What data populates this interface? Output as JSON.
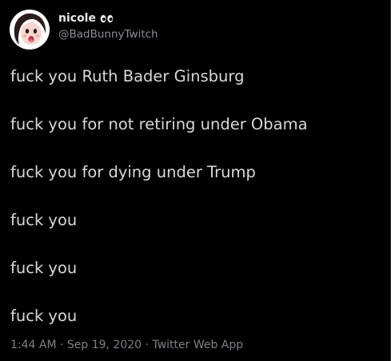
{
  "author": {
    "display_name": "nicole",
    "name_emoji_icon": "eyes-icon",
    "handle": "@BadBunnyTwitch",
    "avatar_icon": "cartoon-face-avatar"
  },
  "tweet": {
    "lines": [
      "fuck you Ruth Bader Ginsburg",
      "fuck you for not retiring under Obama",
      "fuck you for dying under Trump",
      "fuck you",
      "fuck you",
      "fuck you"
    ]
  },
  "meta": {
    "time": "1:44 AM",
    "separator": "·",
    "date": "Sep 19, 2020",
    "source": "Twitter Web App"
  },
  "colors": {
    "background": "#000000",
    "text": "#d9d9d9",
    "secondary": "#7c8188"
  }
}
